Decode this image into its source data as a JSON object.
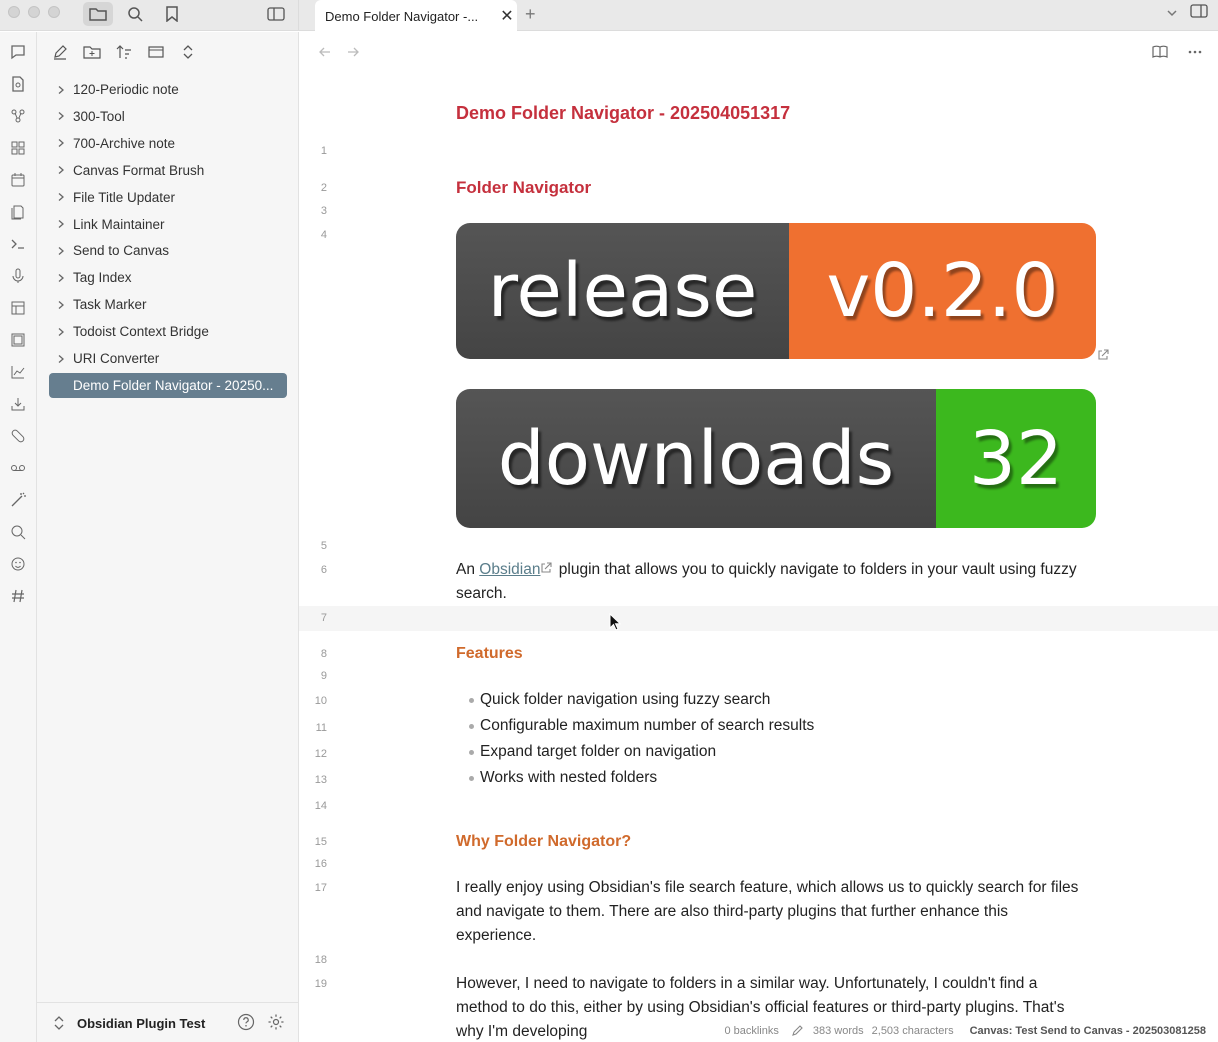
{
  "tabs": {
    "active_title": "Demo Folder Navigator -...",
    "close_glyph": "✕",
    "add_glyph": "+"
  },
  "sidebar": {
    "items": [
      {
        "label": "120-Periodic note"
      },
      {
        "label": "300-Tool"
      },
      {
        "label": "700-Archive note"
      },
      {
        "label": "Canvas Format Brush"
      },
      {
        "label": "File Title Updater"
      },
      {
        "label": "Link Maintainer"
      },
      {
        "label": "Send to Canvas"
      },
      {
        "label": "Tag Index"
      },
      {
        "label": "Task Marker"
      },
      {
        "label": "Todoist Context Bridge"
      },
      {
        "label": "URI Converter"
      }
    ],
    "selected": "Demo Folder Navigator - 20250...",
    "vault_name": "Obsidian Plugin Test"
  },
  "editor": {
    "inline_title": "Demo Folder Navigator - 202504051317",
    "line_numbers": [
      "1",
      "2",
      "3",
      "4",
      "5",
      "6",
      "7",
      "8",
      "9",
      "10",
      "11",
      "12",
      "13",
      "14",
      "15",
      "16",
      "17",
      "18",
      "19"
    ],
    "heading_main": "Folder Navigator",
    "badge_release": {
      "label": "release",
      "value": "v0.2.0",
      "color": "#ef7030"
    },
    "badge_downloads": {
      "label": "downloads",
      "value": "32",
      "color": "#3cb81e"
    },
    "intro_prefix": "An ",
    "intro_link": "Obsidian",
    "intro_rest": " plugin that allows you to quickly navigate to folders in your vault using fuzzy search.",
    "features_heading": "Features",
    "features": [
      "Quick folder navigation using fuzzy search",
      "Configurable maximum number of search results",
      "Expand target folder on navigation",
      "Works with nested folders"
    ],
    "why_heading": "Why Folder Navigator?",
    "why_p1": "I really enjoy using Obsidian's file search feature, which allows us to quickly search for files and navigate to them. There are also third-party plugins that further enhance this experience.",
    "why_p2": "However, I need to navigate to folders in a similar way. Unfortunately, I couldn't find a method to do this, either by using Obsidian's official features or third-party plugins. That's why I'm developing"
  },
  "status_bar": {
    "backlinks": "0 backlinks",
    "words": "383 words",
    "characters": "2,503 characters",
    "canvas": "Canvas: Test Send to Canvas - 202503081258"
  },
  "colors": {
    "heading_red": "#c5303d",
    "heading_orange": "#d06a2c",
    "selected_bg": "#667e8f"
  }
}
